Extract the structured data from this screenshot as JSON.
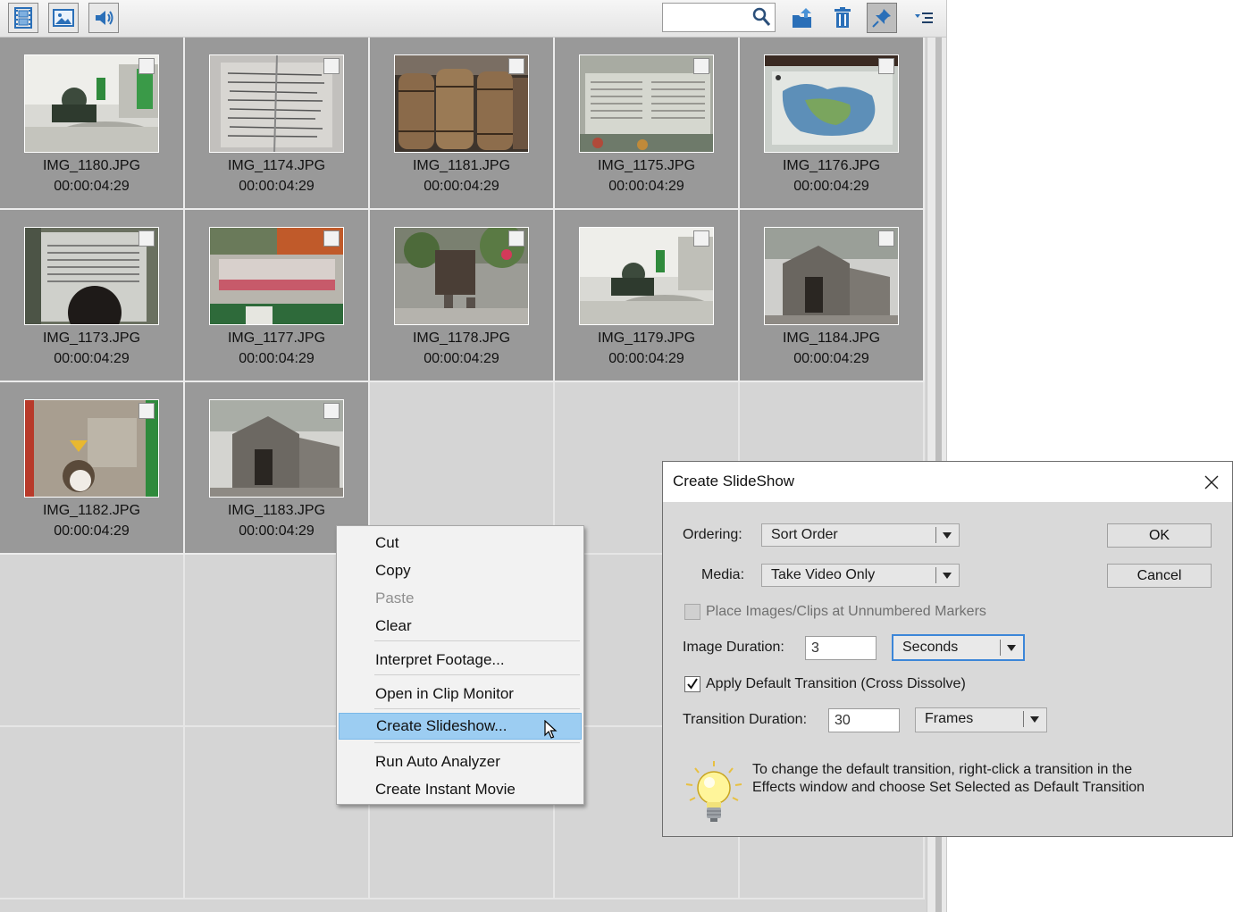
{
  "toolbar": {
    "buttons": [
      {
        "name": "video-filter",
        "icon": "film-icon"
      },
      {
        "name": "image-filter",
        "icon": "image-icon"
      },
      {
        "name": "audio-filter",
        "icon": "speaker-icon"
      },
      {
        "name": "new-item",
        "icon": "folder-up-icon"
      },
      {
        "name": "delete",
        "icon": "trash-icon"
      },
      {
        "name": "pin",
        "icon": "pushpin-icon"
      },
      {
        "name": "options-menu",
        "icon": "list-menu-icon"
      }
    ],
    "search": {
      "value": "",
      "placeholder": "",
      "icon": "search-icon"
    }
  },
  "clips": [
    {
      "name": "IMG_1180.JPG",
      "duration": "00:00:04:29"
    },
    {
      "name": "IMG_1174.JPG",
      "duration": "00:00:04:29"
    },
    {
      "name": "IMG_1181.JPG",
      "duration": "00:00:04:29"
    },
    {
      "name": "IMG_1175.JPG",
      "duration": "00:00:04:29"
    },
    {
      "name": "IMG_1176.JPG",
      "duration": "00:00:04:29"
    },
    {
      "name": "IMG_1173.JPG",
      "duration": "00:00:04:29"
    },
    {
      "name": "IMG_1177.JPG",
      "duration": "00:00:04:29"
    },
    {
      "name": "IMG_1178.JPG",
      "duration": "00:00:04:29"
    },
    {
      "name": "IMG_1179.JPG",
      "duration": "00:00:04:29"
    },
    {
      "name": "IMG_1184.JPG",
      "duration": "00:00:04:29"
    },
    {
      "name": "IMG_1182.JPG",
      "duration": "00:00:04:29"
    },
    {
      "name": "IMG_1183.JPG",
      "duration": "00:00:04:29"
    }
  ],
  "context_menu": {
    "items": [
      {
        "label": "Cut",
        "enabled": true
      },
      {
        "label": "Copy",
        "enabled": true
      },
      {
        "label": "Paste",
        "enabled": false
      },
      {
        "label": "Clear",
        "enabled": true
      },
      {
        "label": "Interpret Footage...",
        "enabled": true
      },
      {
        "label": "Open in Clip Monitor",
        "enabled": true
      },
      {
        "label": "Create Slideshow...",
        "enabled": true,
        "highlighted": true
      },
      {
        "label": "Run Auto Analyzer",
        "enabled": true
      },
      {
        "label": "Create Instant Movie",
        "enabled": true
      }
    ]
  },
  "dialog": {
    "title": "Create SlideShow",
    "ordering_label": "Ordering:",
    "ordering_value": "Sort Order",
    "media_label": "Media:",
    "media_value": "Take Video Only",
    "place_markers_label": "Place Images/Clips at Unnumbered Markers",
    "place_markers_checked": false,
    "image_duration_label": "Image Duration:",
    "image_duration_value": "3",
    "image_duration_unit": "Seconds",
    "apply_transition_label": "Apply Default Transition (Cross Dissolve)",
    "apply_transition_checked": true,
    "transition_duration_label": "Transition Duration:",
    "transition_duration_value": "30",
    "transition_duration_unit": "Frames",
    "ok_label": "OK",
    "cancel_label": "Cancel",
    "tip": "To change the default transition, right-click a transition in the Effects window and choose Set Selected as Default Transition"
  },
  "colors": {
    "toolbar_icon": "#2a6fb8",
    "menu_highlight": "#9ccdf2",
    "selected_cell": "#999999",
    "empty_cell": "#d5d5d5",
    "focus_ring": "#3c86d8"
  }
}
